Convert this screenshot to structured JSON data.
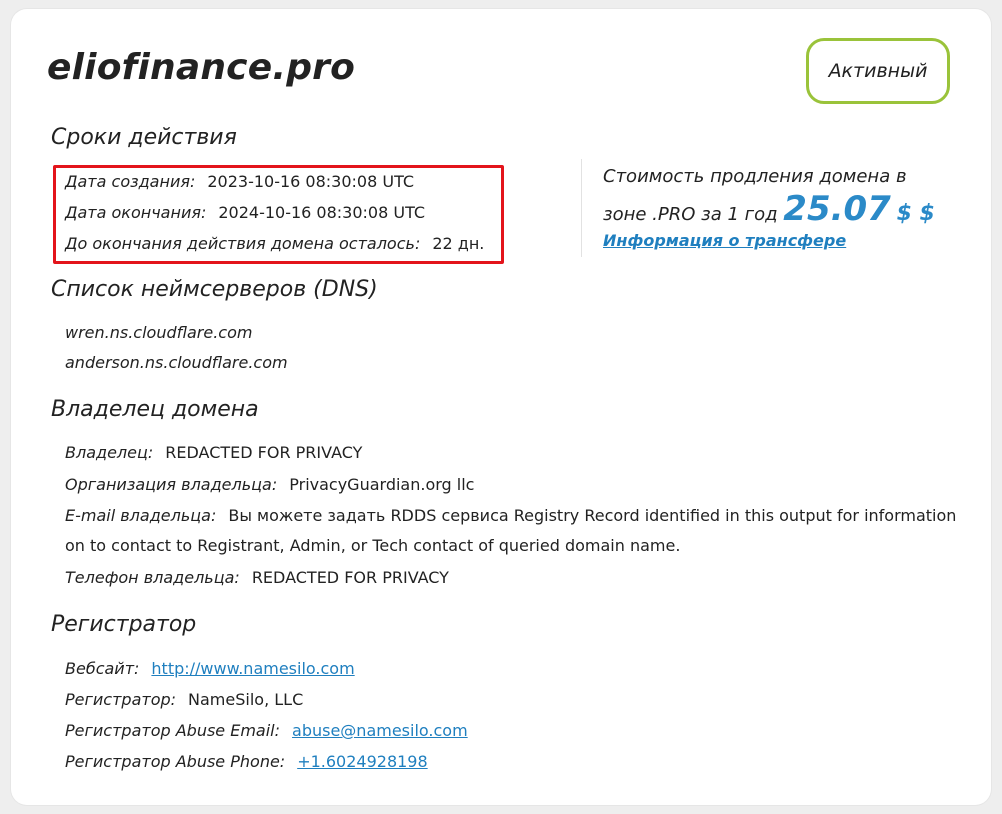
{
  "domain": {
    "name": "eliofinance.pro",
    "status": "Активный"
  },
  "validity": {
    "title": "Сроки действия",
    "rows": [
      {
        "label": "Дата создания:",
        "value": "2023-10-16 08:30:08 UTC"
      },
      {
        "label": "Дата окончания:",
        "value": "2024-10-16 08:30:08 UTC"
      },
      {
        "label": "До окончания действия домена осталось:",
        "value": "22 дн."
      }
    ]
  },
  "renewal": {
    "line1": "Стоимость продления домена в",
    "line2_prefix": "зоне .PRO за 1 год",
    "price": "25.07",
    "currency": "$ $",
    "transfer_link": "Информация о трансфере"
  },
  "dns": {
    "title": "Список неймсерверов (DNS)",
    "servers": [
      "wren.ns.cloudflare.com",
      "anderson.ns.cloudflare.com"
    ]
  },
  "owner": {
    "title": "Владелец домена",
    "owner_label": "Владелец:",
    "owner_value": "REDACTED FOR PRIVACY",
    "org_label": "Организация владельца:",
    "org_value": "PrivacyGuardian.org llc",
    "email_label": "E-mail владельца:",
    "email_value_line1": "Вы можете задать RDDS сервиса Registry Record identified in this output for information",
    "email_value_line2": "on to contact to Registrant, Admin, or Tech contact of queried domain name.",
    "phone_label": "Телефон владельца:",
    "phone_value": "REDACTED FOR PRIVACY"
  },
  "registrar": {
    "title": "Регистратор",
    "website_label": "Вебсайт:",
    "website_value": "http://www.namesilo.com",
    "registrar_label": "Регистратор:",
    "registrar_value": "NameSilo, LLC",
    "abuse_email_label": "Регистратор Abuse Email:",
    "abuse_email_value": "abuse@namesilo.com",
    "abuse_phone_label": "Регистратор Abuse Phone:",
    "abuse_phone_value": "+1.6024928198"
  },
  "colors": {
    "accent": "#2b8ac8",
    "badge_border": "#9ac33a",
    "highlight": "#e3141b"
  }
}
